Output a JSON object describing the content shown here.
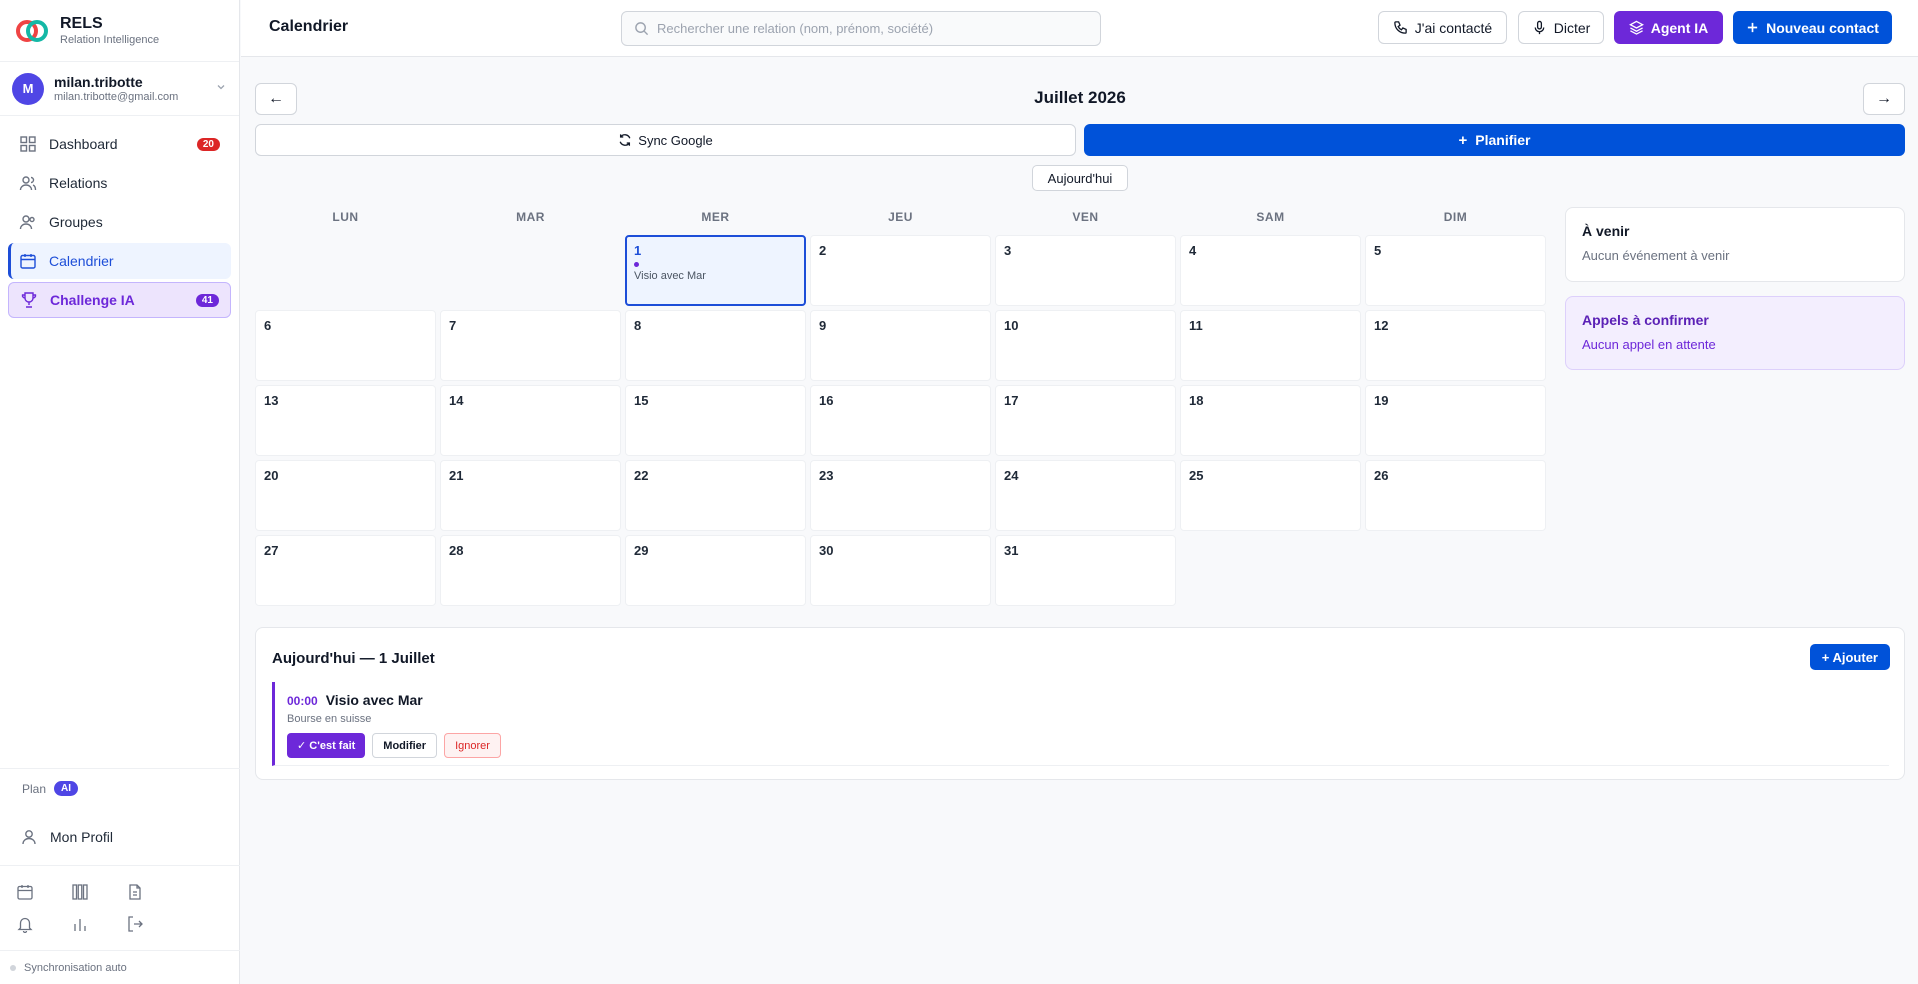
{
  "app": {
    "name": "RELS",
    "tagline": "Relation Intelligence"
  },
  "user": {
    "initial": "M",
    "name": "milan.tribotte",
    "email": "milan.tribotte@gmail.com"
  },
  "sidebar": {
    "items": [
      {
        "label": "Dashboard",
        "icon": "grid-icon",
        "badge": "20"
      },
      {
        "label": "Relations",
        "icon": "users-icon"
      },
      {
        "label": "Groupes",
        "icon": "group-icon"
      },
      {
        "label": "Calendrier",
        "icon": "calendar-icon",
        "active": true
      },
      {
        "label": "Challenge IA",
        "icon": "trophy-icon",
        "badge": "41"
      }
    ],
    "plan_label": "Plan",
    "plan_badge": "AI",
    "profile_label": "Mon Profil",
    "tools": [
      "calendar-icon",
      "columns-icon",
      "document-icon",
      "bell-icon",
      "bar-chart-icon",
      "logout-icon"
    ],
    "sync_status": "Synchronisation auto"
  },
  "header": {
    "title": "Calendrier",
    "search_placeholder": "Rechercher une relation (nom, prénom, société)",
    "btn_contacted": "J'ai contacté",
    "btn_dictate": "Dicter",
    "btn_agent": "Agent IA",
    "btn_new_contact": "Nouveau contact"
  },
  "calendar": {
    "prev": "←",
    "next": "→",
    "month_title": "Juillet 2026",
    "sync_label": "Sync Google",
    "plan_label": "Planifier",
    "today_label": "Aujourd'hui",
    "weekdays": [
      "LUN",
      "MAR",
      "MER",
      "JEU",
      "VEN",
      "SAM",
      "DIM"
    ],
    "days": [
      "1",
      "2",
      "3",
      "4",
      "5",
      "6",
      "7",
      "8",
      "9",
      "10",
      "11",
      "12",
      "13",
      "14",
      "15",
      "16",
      "17",
      "18",
      "19",
      "20",
      "21",
      "22",
      "23",
      "24",
      "25",
      "26",
      "27",
      "28",
      "29",
      "30",
      "31"
    ],
    "event_day_title": "Visio avec Mar"
  },
  "upcoming": {
    "title": "À venir",
    "empty": "Aucun événement à venir"
  },
  "calls": {
    "title": "Appels à confirmer",
    "empty": "Aucun appel en attente"
  },
  "today_section": {
    "title": "Aujourd'hui — 1 Juillet",
    "add_label": "+ Ajouter",
    "event": {
      "time": "00:00",
      "title": "Visio avec Mar",
      "subtitle": "Bourse en suisse",
      "done_label": "✓ C'est fait",
      "edit_label": "Modifier",
      "ignore_label": "Ignorer"
    }
  },
  "colors": {
    "primary": "#0052d9",
    "accent": "#6d28d9",
    "danger": "#dc2626"
  }
}
